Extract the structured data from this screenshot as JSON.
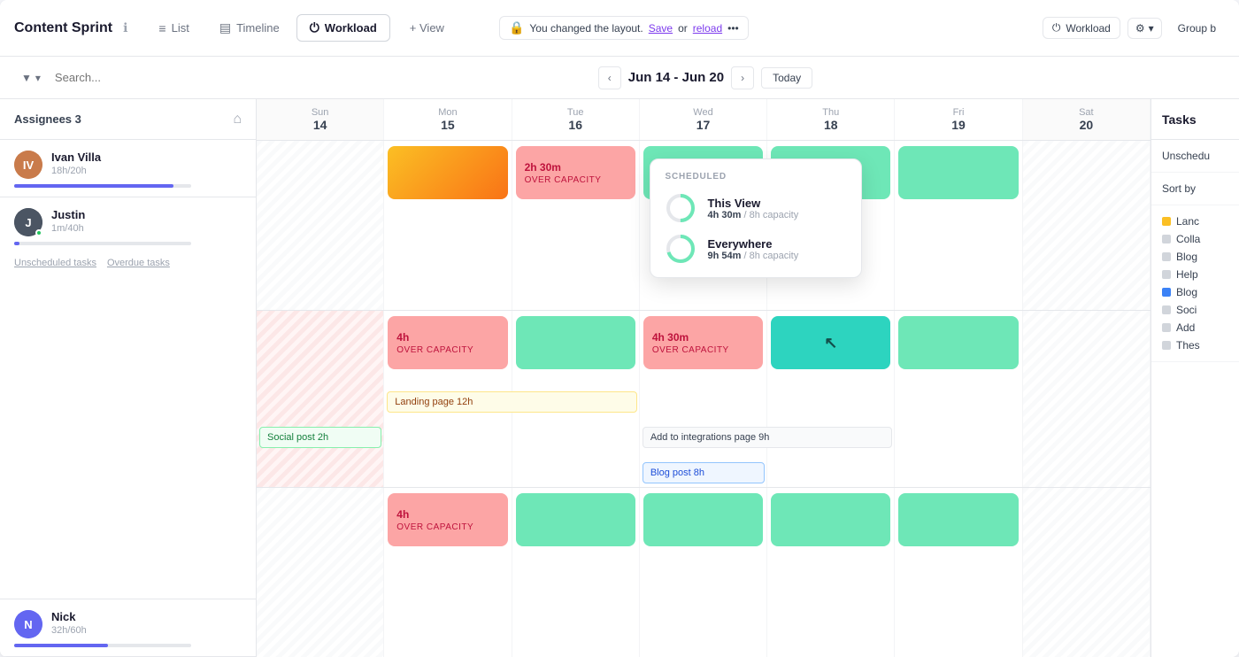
{
  "header": {
    "project_title": "Content Sprint",
    "info_icon": "ℹ",
    "tabs": [
      {
        "id": "list",
        "label": "List",
        "icon": "≡",
        "active": false
      },
      {
        "id": "timeline",
        "label": "Timeline",
        "icon": "▤",
        "active": false
      },
      {
        "id": "workload",
        "label": "Workload",
        "icon": "⏻",
        "active": true
      }
    ],
    "add_view_label": "+ View"
  },
  "toolbar": {
    "filter_icon": "▼",
    "search_placeholder": "Search...",
    "date_range": "Jun 14 - Jun 20",
    "prev_icon": "‹",
    "next_icon": "›",
    "today_label": "Today",
    "banner_text": "You changed the layout.",
    "banner_save": "Save",
    "banner_reload": "reload",
    "banner_more": "•••",
    "workload_label": "Workload",
    "groupby_label": "Group b"
  },
  "assignees": {
    "header_label": "Assignees 3",
    "users": [
      {
        "id": "ivan",
        "name": "Ivan Villa",
        "hours": "18h/20h",
        "progress": 90,
        "avatar_color": "#e07b54",
        "avatar_letter": "I",
        "has_online_dot": false
      },
      {
        "id": "justin",
        "name": "Justin",
        "hours": "1m/40h",
        "progress": 2,
        "avatar_color": "#374151",
        "avatar_letter": "J",
        "has_online_dot": true,
        "unscheduled": "Unscheduled tasks",
        "overdue": "Overdue tasks"
      },
      {
        "id": "nick",
        "name": "Nick",
        "hours": "32h/60h",
        "progress": 53,
        "avatar_color": "#6366f1",
        "avatar_letter": "N",
        "has_online_dot": false
      }
    ]
  },
  "calendar": {
    "days": [
      {
        "name": "Sun",
        "num": "14",
        "weekend": true
      },
      {
        "name": "Mon",
        "num": "15",
        "weekend": false
      },
      {
        "name": "Tue",
        "num": "16",
        "weekend": false
      },
      {
        "name": "Wed",
        "num": "17",
        "weekend": false
      },
      {
        "name": "Thu",
        "num": "18",
        "weekend": false
      },
      {
        "name": "Fri",
        "num": "19",
        "weekend": false
      },
      {
        "name": "Sat",
        "num": "20",
        "weekend": true
      }
    ],
    "rows": [
      {
        "user_id": "ivan",
        "cells": [
          {
            "type": "stripe",
            "block": null
          },
          {
            "type": "normal",
            "block": {
              "style": "orange-cap",
              "label": "",
              "sublabel": ""
            }
          },
          {
            "type": "normal",
            "block": {
              "style": "red-cap",
              "label": "2h 30m",
              "sublabel": "OVER CAPACITY"
            }
          },
          {
            "type": "normal",
            "block": {
              "style": "teal",
              "label": "",
              "sublabel": ""
            }
          },
          {
            "type": "normal",
            "block": {
              "style": "teal",
              "label": "",
              "sublabel": ""
            }
          },
          {
            "type": "normal",
            "block": {
              "style": "teal",
              "label": "",
              "sublabel": ""
            }
          },
          {
            "type": "stripe",
            "block": null
          }
        ]
      },
      {
        "user_id": "justin",
        "cells": [
          {
            "type": "stripe",
            "block": {
              "style": "pink-stripe",
              "label": "",
              "sublabel": ""
            }
          },
          {
            "type": "normal",
            "block": {
              "style": "red-cap",
              "label": "4h",
              "sublabel": "OVER CAPACITY"
            }
          },
          {
            "type": "normal",
            "block": {
              "style": "teal",
              "label": "",
              "sublabel": ""
            }
          },
          {
            "type": "normal",
            "block": {
              "style": "red-cap",
              "label": "4h 30m",
              "sublabel": "OVER CAPACITY"
            }
          },
          {
            "type": "normal",
            "block": {
              "style": "dark-teal",
              "label": "",
              "sublabel": ""
            }
          },
          {
            "type": "normal",
            "block": {
              "style": "teal",
              "label": "",
              "sublabel": ""
            }
          },
          {
            "type": "stripe",
            "block": null
          }
        ],
        "tasks": [
          {
            "label": "Landing page 12h",
            "style": "yellow-task",
            "col_start": 1,
            "col_span": 2
          },
          {
            "label": "Social post 2h",
            "style": "green-task",
            "col_start": 1,
            "col_span": 1
          },
          {
            "label": "Add to integrations page 9h",
            "style": "gray-task",
            "col_start": 3,
            "col_span": 2
          },
          {
            "label": "Blog post 8h",
            "style": "blue-task",
            "col_start": 3,
            "col_span": 1
          }
        ]
      },
      {
        "user_id": "nick",
        "cells": [
          {
            "type": "stripe",
            "block": null
          },
          {
            "type": "normal",
            "block": {
              "style": "red-cap",
              "label": "4h",
              "sublabel": "OVER CAPACITY"
            }
          },
          {
            "type": "normal",
            "block": {
              "style": "teal",
              "label": "",
              "sublabel": ""
            }
          },
          {
            "type": "normal",
            "block": {
              "style": "teal",
              "label": "",
              "sublabel": ""
            }
          },
          {
            "type": "normal",
            "block": {
              "style": "teal",
              "label": "",
              "sublabel": ""
            }
          },
          {
            "type": "normal",
            "block": {
              "style": "teal",
              "label": "",
              "sublabel": ""
            }
          },
          {
            "type": "stripe",
            "block": null
          }
        ]
      }
    ]
  },
  "popup": {
    "title": "SCHEDULED",
    "this_view_label": "This View",
    "this_view_hours": "4h 30m",
    "this_view_capacity": "8h capacity",
    "everywhere_label": "Everywhere",
    "everywhere_hours": "9h 54m",
    "everywhere_capacity": "8h capacity"
  },
  "right_panel": {
    "header": "Tasks",
    "unscheduled_label": "Unschedu",
    "sort_by_label": "Sort by",
    "items": [
      {
        "label": "Lanc",
        "dot_color": "yellow"
      },
      {
        "label": "Colla",
        "dot_color": "gray"
      },
      {
        "label": "Blog",
        "dot_color": "gray"
      },
      {
        "label": "Help",
        "dot_color": "gray"
      },
      {
        "label": "Blog",
        "dot_color": "blue"
      },
      {
        "label": "Soci",
        "dot_color": "gray"
      },
      {
        "label": "Add",
        "dot_color": "gray"
      },
      {
        "label": "Thes",
        "dot_color": "gray"
      }
    ]
  }
}
